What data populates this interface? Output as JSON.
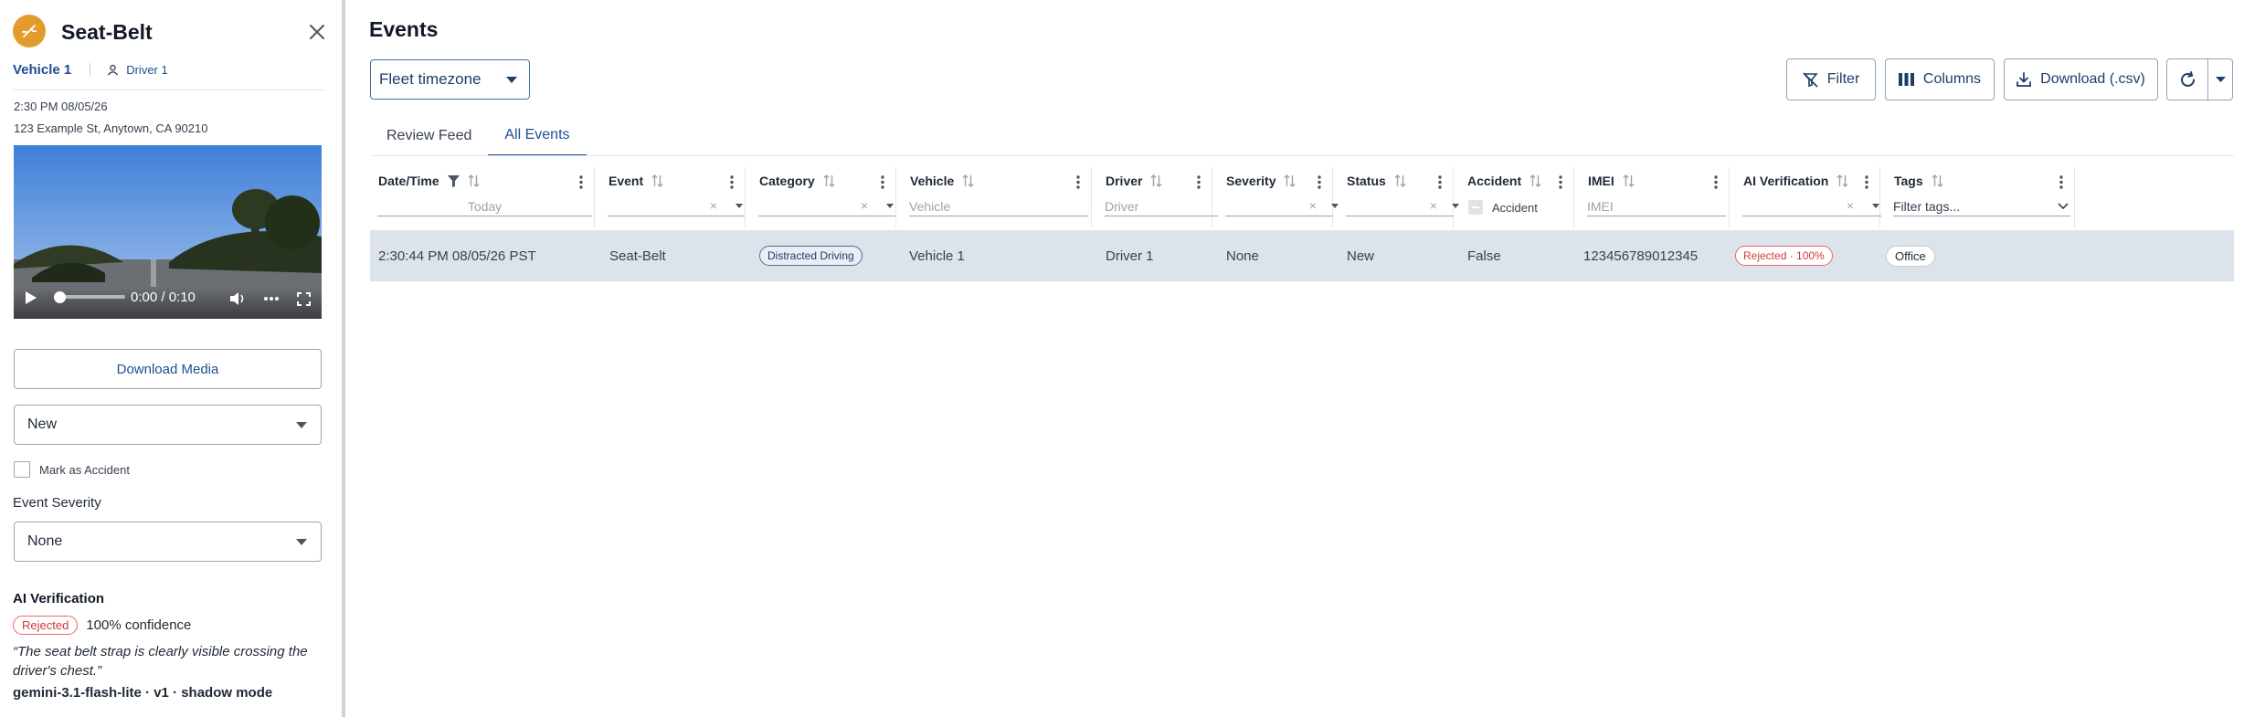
{
  "panel": {
    "title": "Seat-Belt",
    "vehicle": "Vehicle 1",
    "driver": "Driver 1",
    "timestamp": "2:30 PM 08/05/26",
    "address": "123 Example St, Anytown, CA 90210",
    "video": {
      "time": "0:00 / 0:10"
    },
    "download_media_label": "Download Media",
    "status_value": "New",
    "mark_accident_label": "Mark as Accident",
    "event_severity_label": "Event Severity",
    "severity_value": "None",
    "ai": {
      "title": "AI Verification",
      "badge": "Rejected",
      "confidence": "100% confidence",
      "quote": "“The seat belt strap is clearly visible crossing the driver's chest.”",
      "model": "gemini-3.1-flash-lite · v1 · shadow mode"
    }
  },
  "main": {
    "title": "Events",
    "timezone_value": "Fleet timezone",
    "toolbar": {
      "filter": "Filter",
      "columns": "Columns",
      "download": "Download (.csv)"
    },
    "tabs": [
      "Review Feed",
      "All Events"
    ],
    "columns": [
      {
        "title": "Date/Time",
        "filter": "Today"
      },
      {
        "title": "Event",
        "filter": ""
      },
      {
        "title": "Category",
        "filter": ""
      },
      {
        "title": "Vehicle",
        "filter": "Vehicle"
      },
      {
        "title": "Driver",
        "filter": "Driver"
      },
      {
        "title": "Severity",
        "filter": ""
      },
      {
        "title": "Status",
        "filter": ""
      },
      {
        "title": "Accident",
        "filter": "Accident"
      },
      {
        "title": "IMEI",
        "filter": "IMEI"
      },
      {
        "title": "AI Verification",
        "filter": ""
      },
      {
        "title": "Tags",
        "filter": "Filter tags..."
      }
    ],
    "rows": [
      {
        "datetime": "2:30:44 PM 08/05/26 PST",
        "event": "Seat-Belt",
        "category": "Distracted Driving",
        "vehicle": "Vehicle 1",
        "driver": "Driver 1",
        "severity": "None",
        "status": "New",
        "accident": "False",
        "imei": "123456789012345",
        "ai_verification": "Rejected · 100%",
        "tag": "Office"
      }
    ]
  },
  "colors": {
    "brand_orange": "#e39b2e",
    "accent_blue": "#1d4f91",
    "rejected_red": "#d03a3a",
    "row_selected": "#dde3ea"
  }
}
